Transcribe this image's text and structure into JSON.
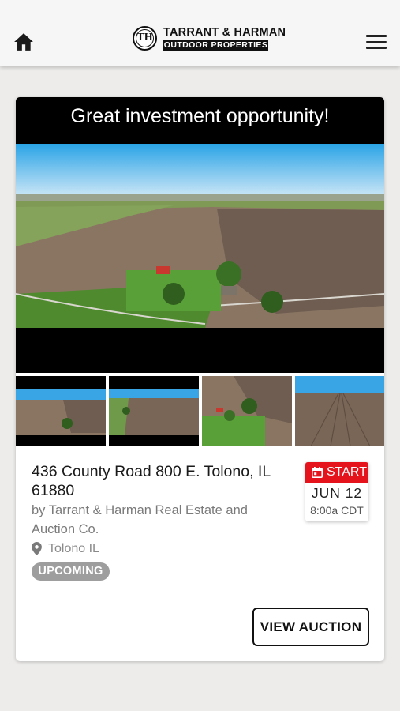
{
  "header": {
    "logo_monogram": "TH",
    "logo_name": "TARRANT & HARMAN",
    "logo_tagline": "OUTDOOR PROPERTIES",
    "left_icon": "home-icon",
    "right_icon": "hamburger-menu-icon"
  },
  "listing": {
    "promo_text": "Great investment opportunity!",
    "title": "436 County Road 800 E. Tolono, IL 61880",
    "by": "by Tarrant & Harman Real Estate and Auction Co.",
    "location": "Tolono IL",
    "status": "UPCOMING",
    "start_label": "START",
    "start_day": "JUN 12",
    "start_time": "8:00a CDT",
    "cta": "VIEW AUCTION",
    "thumbnail_count": 4
  },
  "colors": {
    "accent_red": "#e5131b",
    "badge_gray": "#9e9e9e",
    "background": "#edecea"
  }
}
